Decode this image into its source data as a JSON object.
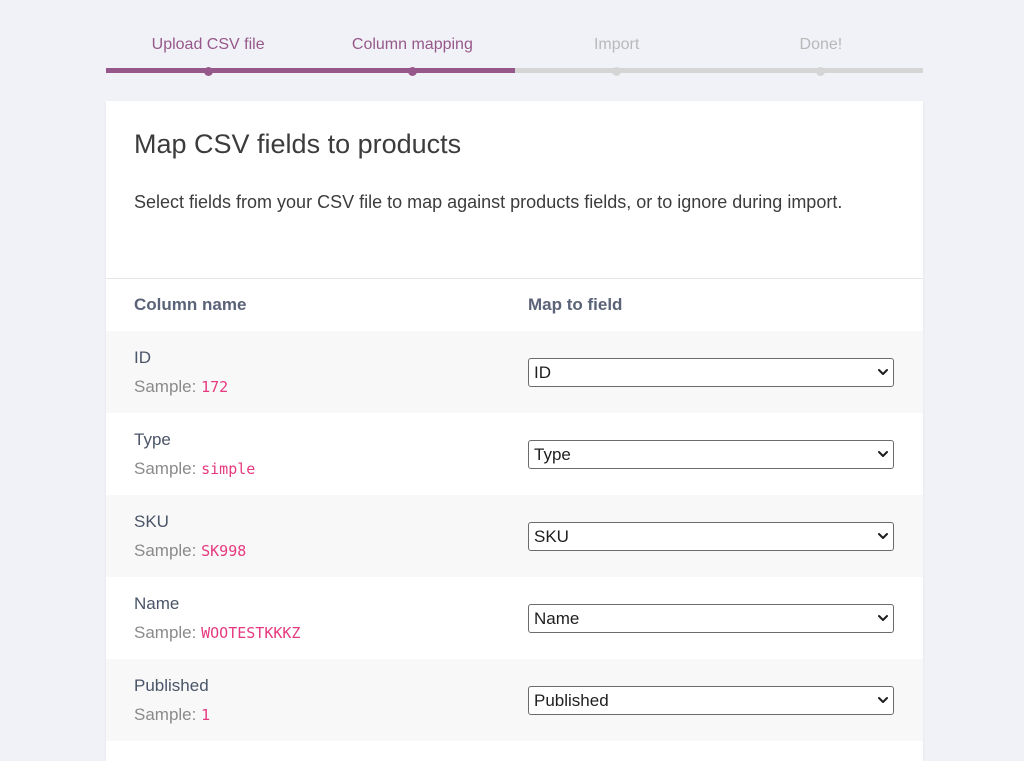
{
  "steps": [
    {
      "label": "Upload CSV file",
      "state": "done"
    },
    {
      "label": "Column mapping",
      "state": "done"
    },
    {
      "label": "Import",
      "state": "todo"
    },
    {
      "label": "Done!",
      "state": "todo"
    }
  ],
  "card": {
    "title": "Map CSV fields to products",
    "description": "Select fields from your CSV file to map against products fields, or to ignore during import."
  },
  "table": {
    "headers": {
      "column_name": "Column name",
      "map_to_field": "Map to field"
    },
    "sample_prefix": "Sample:",
    "rows": [
      {
        "name": "ID",
        "sample": "172",
        "mapped": "ID"
      },
      {
        "name": "Type",
        "sample": "simple",
        "mapped": "Type"
      },
      {
        "name": "SKU",
        "sample": "SK998",
        "mapped": "SKU"
      },
      {
        "name": "Name",
        "sample": "WOOTESTKKKZ",
        "mapped": "Name"
      },
      {
        "name": "Published",
        "sample": "1",
        "mapped": "Published"
      }
    ]
  },
  "colors": {
    "accent": "#96588a",
    "sample_value": "#e6397f",
    "inactive_step": "#d5d5d5"
  },
  "icons": {
    "select_arrow": "chevron-down-icon"
  }
}
